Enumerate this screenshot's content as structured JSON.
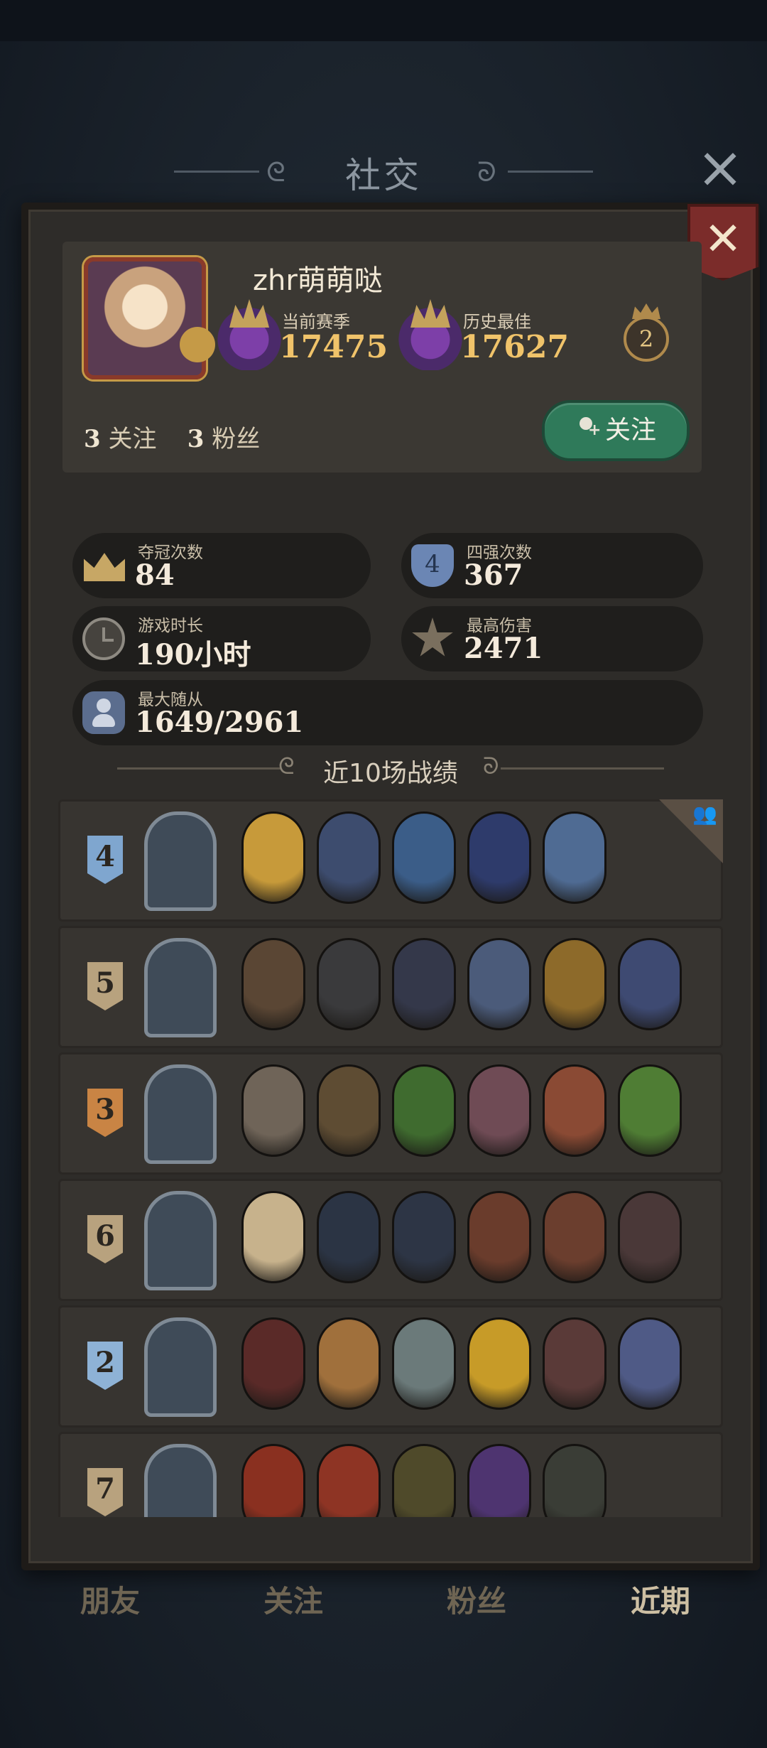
{
  "title": "社交",
  "profile": {
    "username": "zhr萌萌哒",
    "current_season_label": "当前赛季",
    "current_season_value": "17475",
    "best_label": "历史最佳",
    "best_value": "17627",
    "crown_level": "2",
    "following_count": "3",
    "following_label": "关注",
    "followers_count": "3",
    "followers_label": "粉丝",
    "follow_button": "关注"
  },
  "stats": {
    "champion": {
      "label": "夺冠次数",
      "value": "84"
    },
    "top4": {
      "label": "四强次数",
      "value": "367",
      "icon_glyph": "4"
    },
    "playtime": {
      "label": "游戏时长",
      "value": "190小时"
    },
    "max_damage": {
      "label": "最高伤害",
      "value": "2471"
    },
    "max_minion": {
      "label": "最大随从",
      "value": "1649/2961"
    }
  },
  "recent_title": "近10场战绩",
  "matches": [
    {
      "place": "4",
      "place_color": "#7fa6cf",
      "team": true,
      "minions": [
        "#c79a3a",
        "#3d4c6e",
        "#3b5d88",
        "#2e3b6b",
        "#4f6b93"
      ]
    },
    {
      "place": "5",
      "place_color": "#b8a27e",
      "minions": [
        "#5a4634",
        "#3a3a3c",
        "#34384a",
        "#4b5b7a",
        "#8d6a2a",
        "#3e4a72"
      ]
    },
    {
      "place": "3",
      "place_color": "#c98444",
      "minions": [
        "#6f6458",
        "#5e4c33",
        "#3f6b2f",
        "#6f4b55",
        "#8a4a34",
        "#4f7d34"
      ]
    },
    {
      "place": "6",
      "place_color": "#b8a27e",
      "minions": [
        "#c7b28c",
        "#2b3444",
        "#2d3545",
        "#6a3c2c",
        "#6b3e2e",
        "#4a3838"
      ]
    },
    {
      "place": "2",
      "place_color": "#8eb2d6",
      "minions": [
        "#5a2a28",
        "#a0703c",
        "#6b7a7a",
        "#c79b28",
        "#5a3a38",
        "#4f5a86"
      ]
    },
    {
      "place": "7",
      "place_color": "#b8a27e",
      "minions": [
        "#8a3020",
        "#8e3424",
        "#4f4a2a",
        "#4e3470",
        "#3a3d36"
      ]
    }
  ],
  "tabs": [
    "朋友",
    "关注",
    "粉丝",
    "近期"
  ],
  "active_tab": "近期",
  "colors": {
    "accent_green": "#2f7a5a",
    "close_red": "#7b2c2a",
    "gold": "#f0c36a"
  }
}
